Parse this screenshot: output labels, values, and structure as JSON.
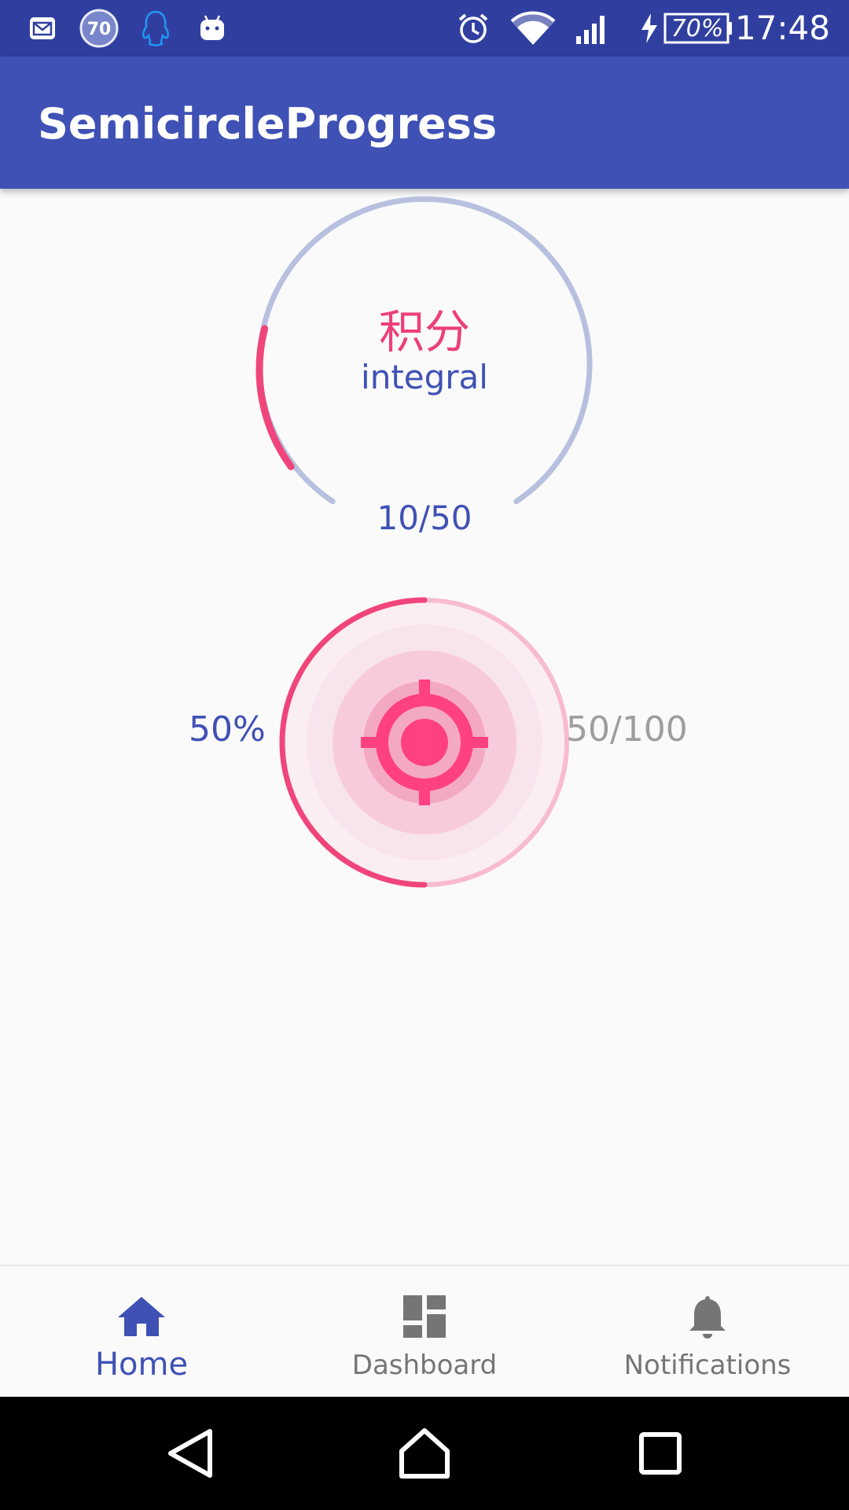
{
  "status_bar": {
    "time": "17:48",
    "battery_percent": "70%",
    "notification_badge": "70",
    "icons": [
      "mail-icon",
      "progress-badge-icon",
      "qq-icon",
      "android-icon",
      "alarm-icon",
      "wifi-icon",
      "signal-icon",
      "charging-icon",
      "battery-icon"
    ]
  },
  "app_bar": {
    "title": "SemicircleProgress"
  },
  "semicircle_progress": {
    "title_cn": "积分",
    "subtitle": "integral",
    "value_text": "10/50",
    "progress_fraction": 0.2,
    "track_color": "#b8c0e0",
    "progress_color": "#f0457a"
  },
  "circle_progress": {
    "percent_text": "50%",
    "value_text": "50/100",
    "progress_fraction": 0.5,
    "track_color": "#f8bbd0",
    "progress_color": "#f0457a",
    "center_icon": "crosshair-icon"
  },
  "bottom_nav": {
    "items": [
      {
        "label": "Home",
        "icon": "home-icon",
        "active": true
      },
      {
        "label": "Dashboard",
        "icon": "dashboard-icon",
        "active": false
      },
      {
        "label": "Notifications",
        "icon": "bell-icon",
        "active": false
      }
    ],
    "active_color": "#3f51b5",
    "inactive_color": "#757575"
  },
  "system_nav": {
    "buttons": [
      "back-icon",
      "home-circle-icon",
      "recents-icon"
    ]
  },
  "colors": {
    "primary": "#3f51b5",
    "primary_dark": "#303f9f",
    "accent": "#f0457a"
  }
}
